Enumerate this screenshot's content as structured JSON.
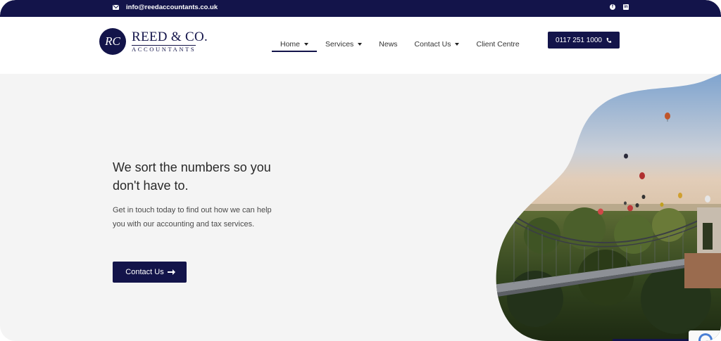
{
  "topbar": {
    "email": "info@reedaccountants.co.uk",
    "social_icons": [
      "facebook-icon",
      "linkedin-icon"
    ],
    "background": "#13144a"
  },
  "header": {
    "logo_monogram": "RC",
    "logo_name": "REED & CO.",
    "logo_sub": "ACCOUNTANTS",
    "nav": [
      {
        "label": "Home",
        "dropdown": true,
        "active": true
      },
      {
        "label": "Services",
        "dropdown": true
      },
      {
        "label": "News",
        "dropdown": false
      },
      {
        "label": "Contact Us",
        "dropdown": true
      },
      {
        "label": "Client Centre",
        "dropdown": false
      }
    ],
    "phone": "0117 251 1000"
  },
  "hero": {
    "headline": "We sort the numbers so you don't have to.",
    "subtext": "Get in touch today to find out how we can help you with our accounting and tax services.",
    "cta_label": "Contact Us",
    "image_icon": "bridge-balloons-photo"
  },
  "colors": {
    "brand": "#13144a",
    "hero_background": "#f4f4f4"
  }
}
